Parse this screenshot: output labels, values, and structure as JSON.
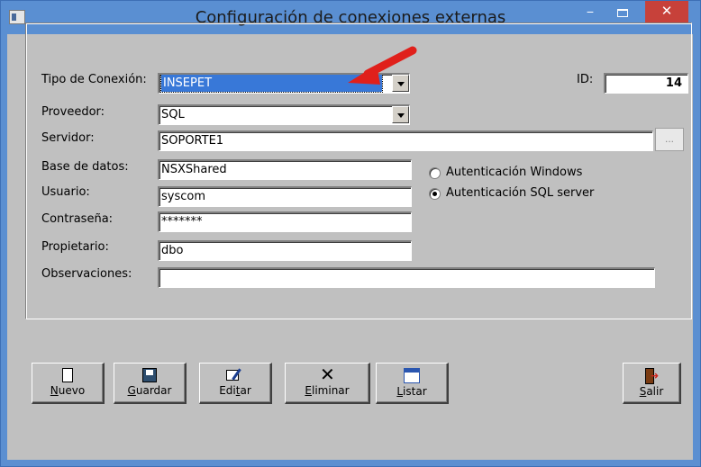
{
  "window": {
    "title": "Configuración de conexiones externas",
    "minimize_glyph": "−",
    "close_glyph": "✕"
  },
  "form": {
    "tipo_conexion": {
      "label": "Tipo de Conexión:",
      "value": "INSEPET"
    },
    "id": {
      "label": "ID:",
      "value": "14"
    },
    "proveedor": {
      "label": "Proveedor:",
      "value": "SQL"
    },
    "servidor": {
      "label": "Servidor:",
      "value": "SOPORTE1",
      "browse_label": "..."
    },
    "base_datos": {
      "label": "Base de datos:",
      "value": "NSXShared"
    },
    "usuario": {
      "label": "Usuario:",
      "value": "syscom"
    },
    "contrasena": {
      "label": "Contraseña:",
      "value": "*******"
    },
    "propietario": {
      "label": "Propietario:",
      "value": "dbo"
    },
    "observaciones": {
      "label": "Observaciones:",
      "value": ""
    }
  },
  "auth": {
    "options": [
      {
        "label": "Autenticación Windows",
        "selected": false
      },
      {
        "label": "Autenticación SQL server",
        "selected": true
      }
    ]
  },
  "toolbar": {
    "nuevo": {
      "mnemonic": "N",
      "rest": "uevo",
      "icon": "new-document-icon"
    },
    "guardar": {
      "mnemonic": "G",
      "rest": "uardar",
      "icon": "floppy-disk-icon"
    },
    "editar": {
      "pre": "Edi",
      "mnemonic": "t",
      "rest": "ar",
      "icon": "edit-icon"
    },
    "eliminar": {
      "mnemonic": "E",
      "rest": "liminar",
      "icon": "delete-x-icon"
    },
    "listar": {
      "mnemonic": "L",
      "rest": "istar",
      "icon": "calendar-list-icon"
    },
    "salir": {
      "mnemonic": "S",
      "rest": "alir",
      "icon": "exit-door-icon"
    }
  },
  "colors": {
    "titlebar": "#5a8fd2",
    "close_button": "#c7413a",
    "dialog_face": "#c0c0c0",
    "selection": "#3878d8",
    "annotation_arrow": "#e0201b"
  }
}
